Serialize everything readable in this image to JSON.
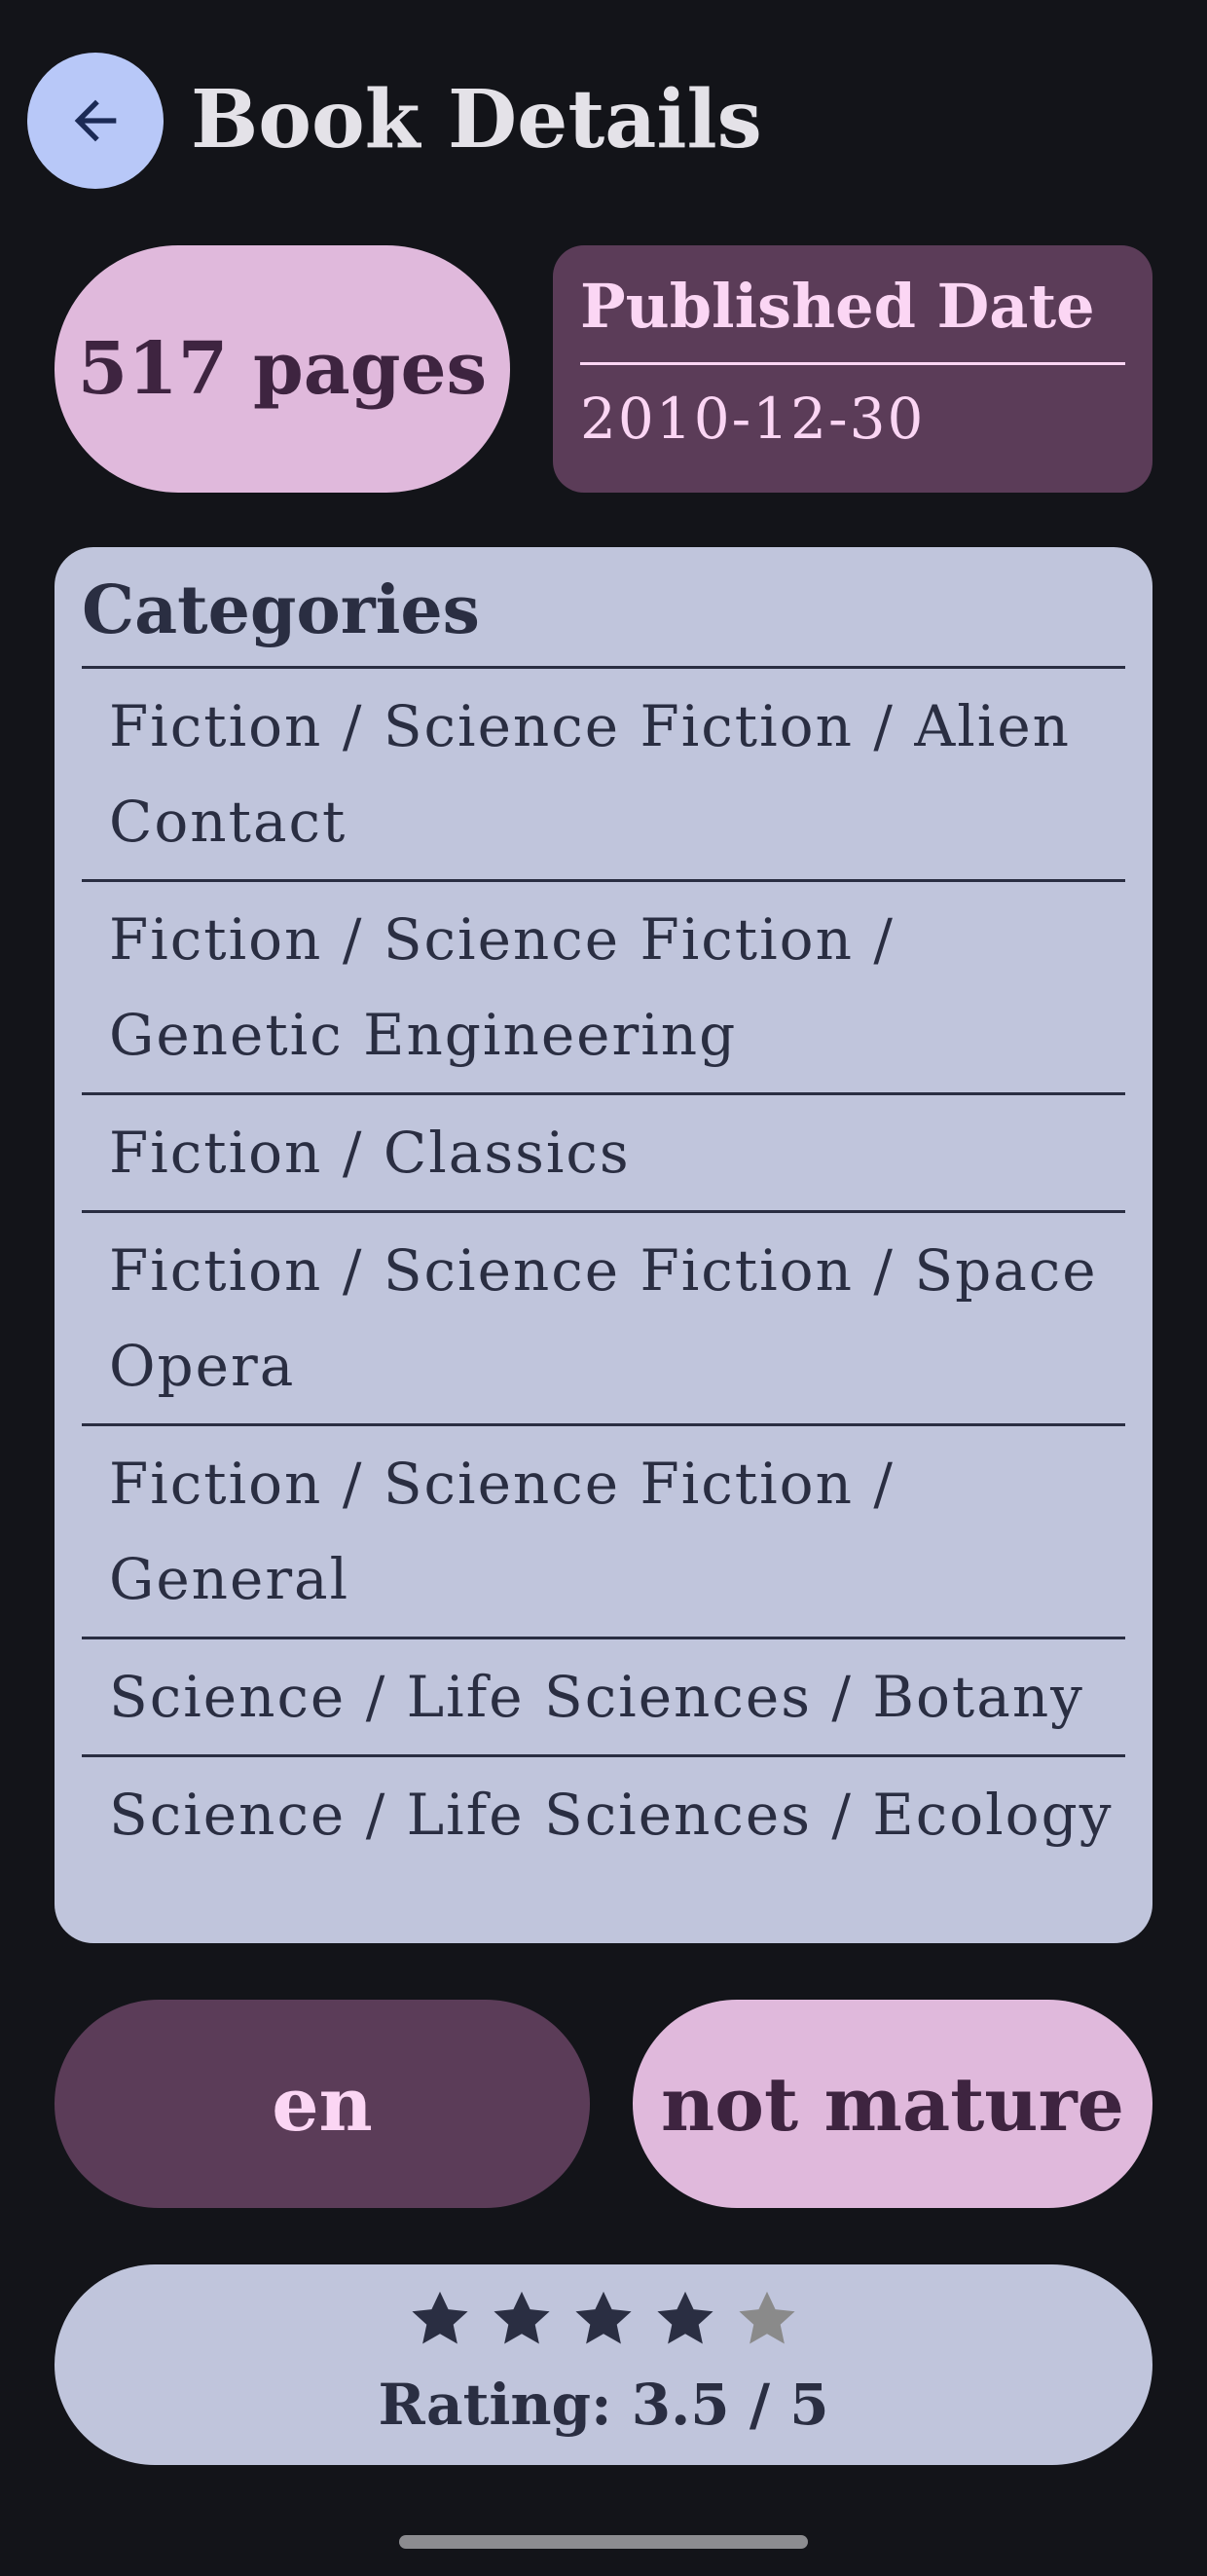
{
  "header": {
    "title": "Book Details",
    "back_icon": "arrow-left-icon"
  },
  "pages": {
    "label": "517 pages"
  },
  "published": {
    "label": "Published Date",
    "value": "2010-12-30"
  },
  "categories": {
    "heading": "Categories",
    "items": [
      "Fiction / Science Fiction / Alien Contact",
      "Fiction / Science Fiction / Genetic Engineering",
      "Fiction / Classics",
      "Fiction / Science Fiction / Space Opera",
      "Fiction / Science Fiction / General",
      "Science / Life Sciences / Botany",
      "Science / Life Sciences / Ecology"
    ]
  },
  "language": {
    "value": "en"
  },
  "maturity": {
    "value": "not mature"
  },
  "rating": {
    "value": 3.5,
    "max": 5,
    "filled_stars": 4,
    "label": "Rating: 3.5 / 5"
  },
  "colors": {
    "background": "#131419",
    "back_button": "#b8c8f8",
    "pink_container": "#e0b9dc",
    "plum_container": "#5b3c58",
    "lavender_container": "#c0c5dc",
    "star_filled": "#2a2e42",
    "star_empty": "#8a8a8a"
  }
}
